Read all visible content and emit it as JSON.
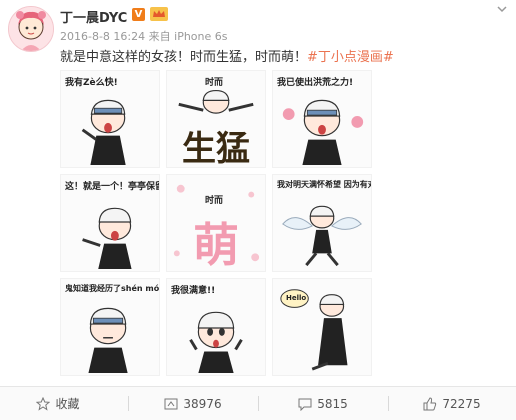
{
  "post": {
    "username": "丁一晨DYC",
    "vip_badge": "V",
    "timestamp": "2016-8-8 16:24",
    "source_prefix": "来自",
    "source": "iPhone 6s",
    "text_plain": "就是中意这样的女孩！时而生猛，时而萌！",
    "hashtag": "#丁小点漫画#"
  },
  "stickers": [
    {
      "caption": "我有Zè么快!"
    },
    {
      "caption": "时而",
      "big": "生猛"
    },
    {
      "caption": "我已使出洪荒之力!"
    },
    {
      "caption": "这！就是一个！亭亭保留的我！"
    },
    {
      "caption": "时而",
      "big": "萌"
    },
    {
      "caption": "我对明天满怀希望 因为有对手又萌"
    },
    {
      "caption": "鬼知道我经历了shén mó"
    },
    {
      "caption": "我很满意!!"
    },
    {
      "caption": "Hello"
    }
  ],
  "footer": {
    "favorite_label": "收藏",
    "repost_count": "38976",
    "comment_count": "5815",
    "like_count": "72275"
  },
  "colors": {
    "hashtag": "#eb7350",
    "vip": "#f07d1a",
    "big_word_dark": "#3a2a12",
    "big_word_pink": "#f29bb0"
  }
}
